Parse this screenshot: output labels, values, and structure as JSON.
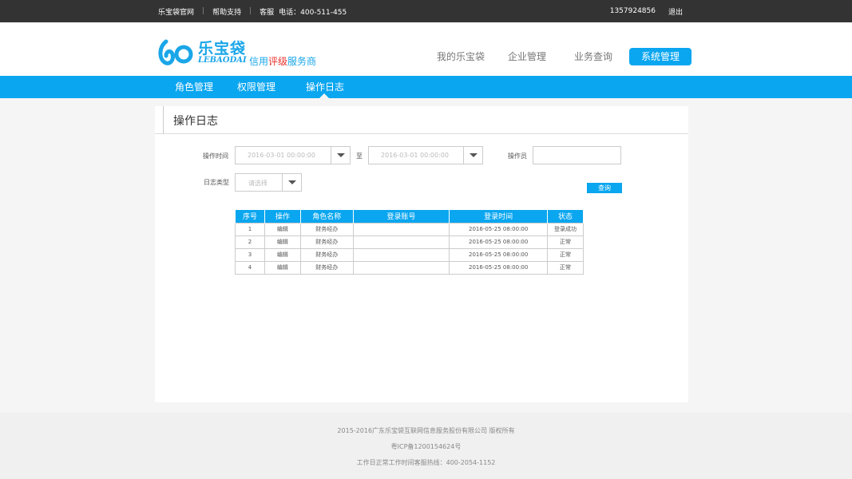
{
  "topbar": {
    "official_site": "乐宝袋官网",
    "help": "帮助支持",
    "service": "客服",
    "phone_label": "电话：400-511-455",
    "user": "1357924856",
    "logout": "退出"
  },
  "logo": {
    "brand": "乐宝袋",
    "en": "LEBAODAI",
    "slogan_a": "信用",
    "slogan_b": "评级",
    "slogan_c": "服务商"
  },
  "main_nav": [
    "我的乐宝袋",
    "企业管理",
    "业务查询",
    "系统管理"
  ],
  "sub_nav": [
    "角色管理",
    "权限管理",
    "操作日志"
  ],
  "panel": {
    "title": "操作日志",
    "op_time_label": "操作时间",
    "date_from": "2016-03-01  00:00:00",
    "to_label": "至",
    "date_to": "2016-03-01  00:00:00",
    "operator_label": "操作员",
    "operator_value": "",
    "log_type_label": "日志类型",
    "log_type_placeholder": "请选择",
    "query_button": "查询"
  },
  "table": {
    "headers": [
      "序号",
      "操作",
      "角色名称",
      "登录账号",
      "登录时间",
      "状态"
    ],
    "rows": [
      [
        "1",
        "编辑",
        "财务经办",
        "",
        "2016-05-25 08:00:00",
        "登录成功"
      ],
      [
        "2",
        "编辑",
        "财务经办",
        "",
        "2016-05-25 08:00:00",
        "正常"
      ],
      [
        "3",
        "编辑",
        "财务经办",
        "",
        "2016-05-25 08:00:00",
        "正常"
      ],
      [
        "4",
        "编辑",
        "财务经办",
        "",
        "2016-05-25 08:00:00",
        "正常"
      ]
    ]
  },
  "footer": {
    "copyright": "2015-2016广东乐宝袋互联网信息服务股份有限公司 版权所有",
    "icp": "粤ICP备1200154624号",
    "hotline": "工作日正常工作时间客服热线：400-2054-1152"
  },
  "colors": {
    "accent": "#0aa6f0",
    "topbar": "#333333",
    "slogan_red": "#e8332e"
  }
}
